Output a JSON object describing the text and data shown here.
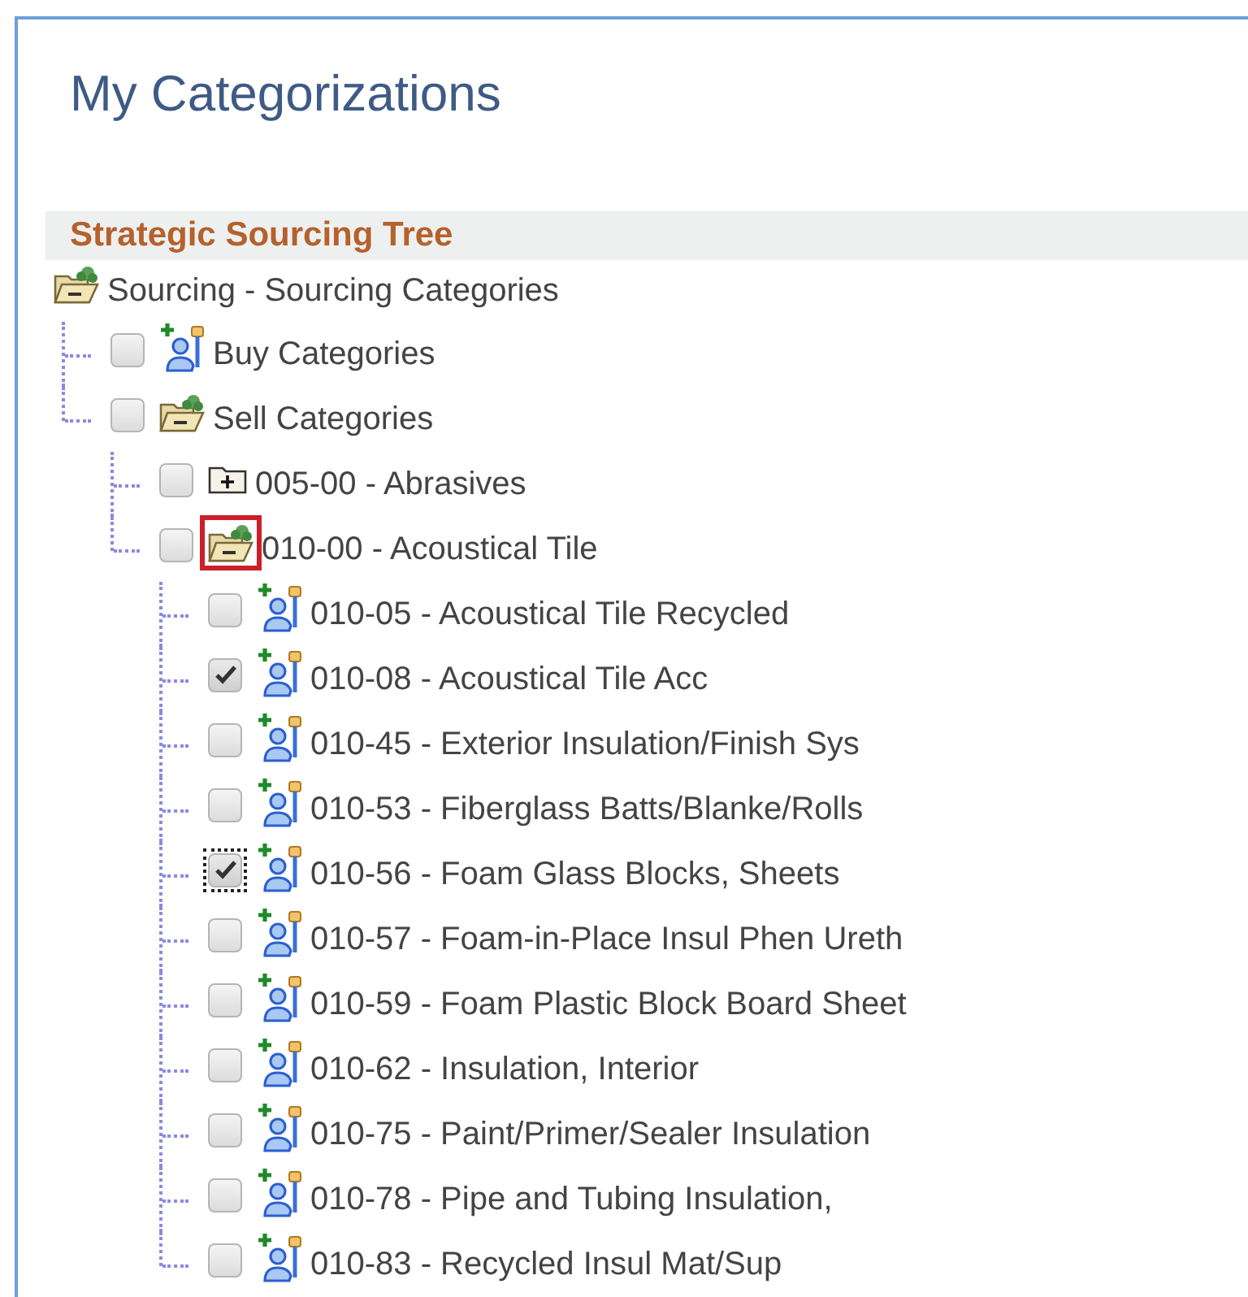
{
  "page_title": "My Categorizations",
  "tree": {
    "title": "Strategic Sourcing Tree",
    "root": {
      "label": "Sourcing - Sourcing Categories",
      "kind": "folder-open",
      "children": [
        {
          "label": "Buy Categories",
          "kind": "node",
          "checked": false,
          "focused": false,
          "highlighted": false
        },
        {
          "label": "Sell Categories",
          "kind": "folder-open",
          "checked": false,
          "focused": false,
          "highlighted": false,
          "children": [
            {
              "label": "005-00 - Abrasives",
              "kind": "folder-closed",
              "checked": false,
              "focused": false,
              "highlighted": false
            },
            {
              "label": "010-00 - Acoustical Tile",
              "kind": "folder-open",
              "checked": false,
              "focused": false,
              "highlighted": true,
              "children": [
                {
                  "label": "010-05 - Acoustical Tile Recycled",
                  "kind": "node",
                  "checked": false,
                  "focused": false,
                  "highlighted": false
                },
                {
                  "label": "010-08 - Acoustical Tile Acc",
                  "kind": "node",
                  "checked": true,
                  "focused": false,
                  "highlighted": false
                },
                {
                  "label": "010-45 - Exterior Insulation/Finish Sys",
                  "kind": "node",
                  "checked": false,
                  "focused": false,
                  "highlighted": false
                },
                {
                  "label": "010-53 - Fiberglass Batts/Blanke/Rolls",
                  "kind": "node",
                  "checked": false,
                  "focused": false,
                  "highlighted": false
                },
                {
                  "label": "010-56 - Foam Glass Blocks, Sheets",
                  "kind": "node",
                  "checked": true,
                  "focused": true,
                  "highlighted": false
                },
                {
                  "label": "010-57 - Foam-in-Place Insul Phen Ureth",
                  "kind": "node",
                  "checked": false,
                  "focused": false,
                  "highlighted": false
                },
                {
                  "label": "010-59 - Foam Plastic Block Board Sheet",
                  "kind": "node",
                  "checked": false,
                  "focused": false,
                  "highlighted": false
                },
                {
                  "label": "010-62 - Insulation, Interior",
                  "kind": "node",
                  "checked": false,
                  "focused": false,
                  "highlighted": false
                },
                {
                  "label": "010-75 - Paint/Primer/Sealer Insulation",
                  "kind": "node",
                  "checked": false,
                  "focused": false,
                  "highlighted": false
                },
                {
                  "label": "010-78 - Pipe and Tubing Insulation,",
                  "kind": "node",
                  "checked": false,
                  "focused": false,
                  "highlighted": false
                },
                {
                  "label": "010-83 - Recycled Insul Mat/Sup",
                  "kind": "node",
                  "checked": false,
                  "focused": false,
                  "highlighted": false
                }
              ]
            }
          ]
        }
      ]
    }
  }
}
